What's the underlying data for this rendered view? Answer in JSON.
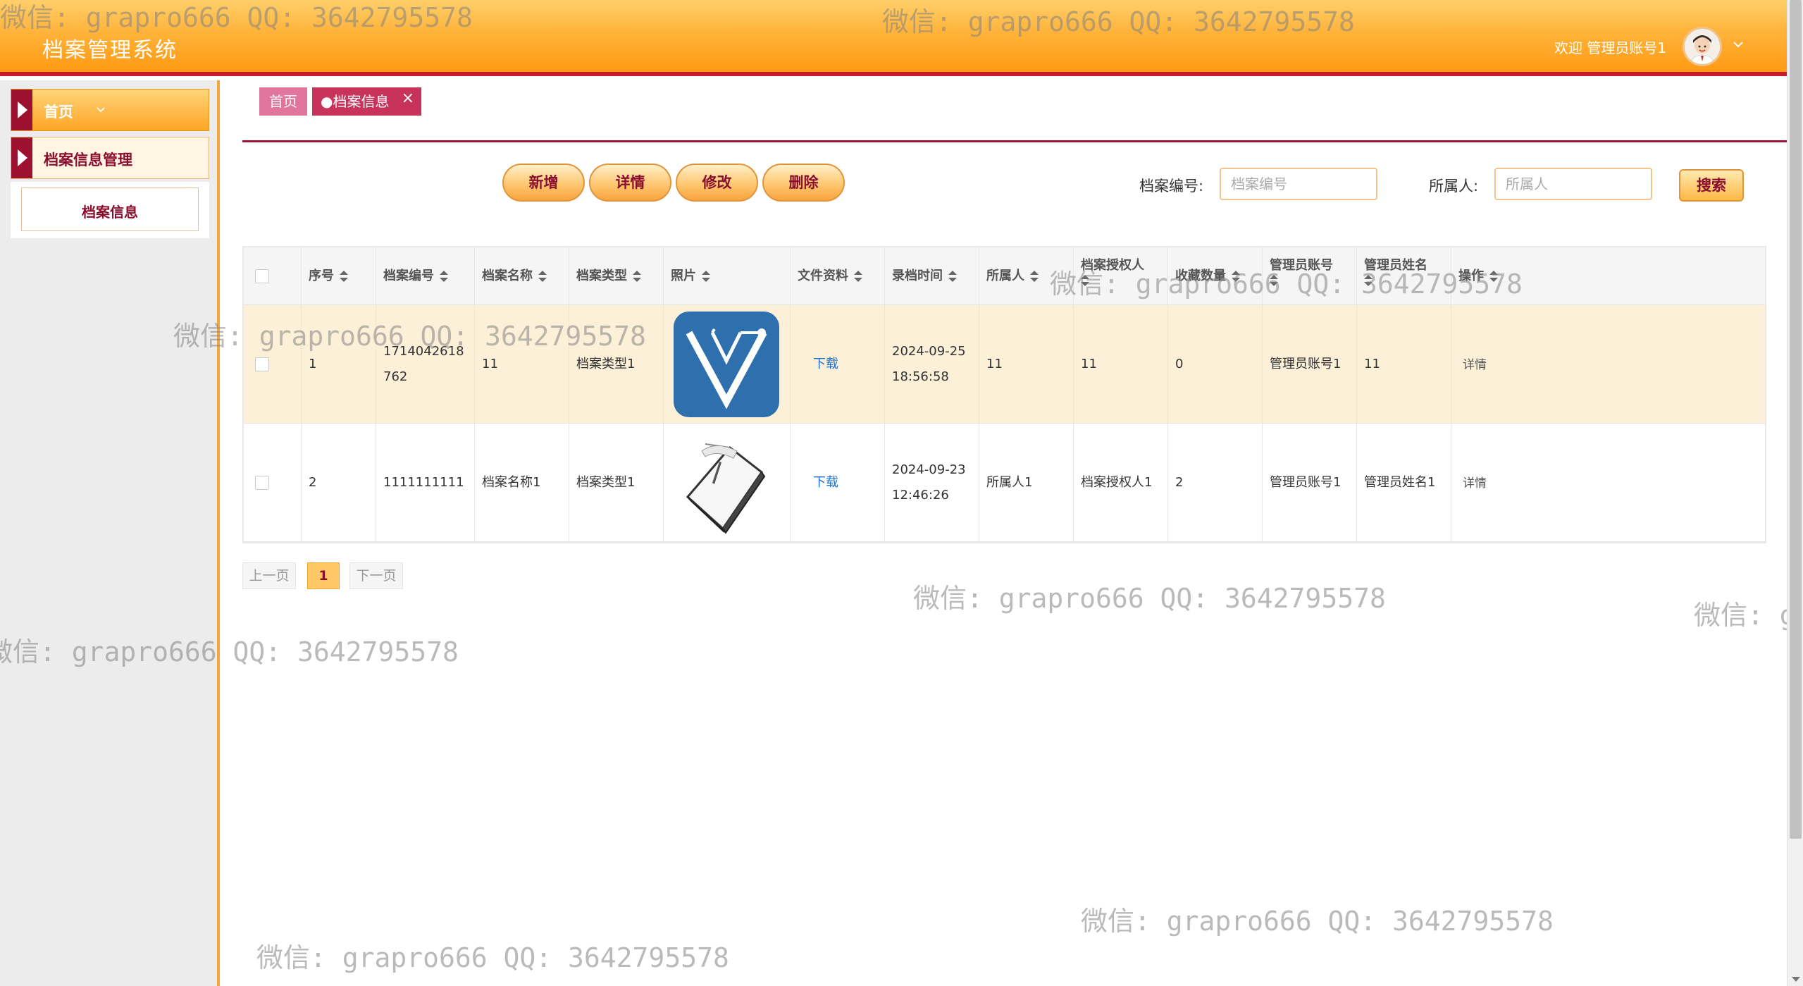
{
  "header": {
    "app_title": "档案管理系统",
    "welcome": "欢迎 管理员账号1"
  },
  "sidebar": {
    "home": "首页",
    "group": "档案信息管理",
    "sub_item": "档案信息"
  },
  "tabs": {
    "home": "首页",
    "active": "●档案信息",
    "close": "×"
  },
  "toolbar": {
    "add": "新增",
    "detail": "详情",
    "edit": "修改",
    "delete": "删除"
  },
  "search": {
    "code_label": "档案编号:",
    "code_placeholder": "档案编号",
    "owner_label": "所属人:",
    "owner_placeholder": "所属人",
    "button": "搜索"
  },
  "table": {
    "columns": [
      "序号",
      "档案编号",
      "档案名称",
      "档案类型",
      "照片",
      "文件资料",
      "录档时间",
      "所属人",
      "档案授权人",
      "收藏数量",
      "管理员账号",
      "管理员姓名",
      "操作"
    ],
    "rows": [
      {
        "index": "1",
        "code_line1": "1714042618",
        "code_line2": "762",
        "name": "11",
        "type": "档案类型1",
        "file": "下载",
        "date": "2024-09-25",
        "time": "18:56:58",
        "owner": "11",
        "authorizer": "11",
        "favorites": "0",
        "admin_account": "管理员账号1",
        "admin_name": "11",
        "action": "详情"
      },
      {
        "index": "2",
        "code_line1": "1111111111",
        "code_line2": "",
        "name": "档案名称1",
        "type": "档案类型1",
        "file": "下载",
        "date": "2024-09-23",
        "time": "12:46:26",
        "owner": "所属人1",
        "authorizer": "档案授权人1",
        "favorites": "2",
        "admin_account": "管理员账号1",
        "admin_name": "管理员姓名1",
        "action": "详情"
      }
    ]
  },
  "pagination": {
    "prev": "上一页",
    "current": "1",
    "next": "下一页"
  },
  "watermark": "微信: grapro666 QQ: 3642795578",
  "colors": {
    "header_gradient_top": "#ffcf6a",
    "header_gradient_bottom": "#ff9a14",
    "accent_red": "#c8335c",
    "dark_red": "#8a0f2e",
    "row_highlight": "#fcf0d8",
    "link_blue": "#1e6fd0"
  }
}
